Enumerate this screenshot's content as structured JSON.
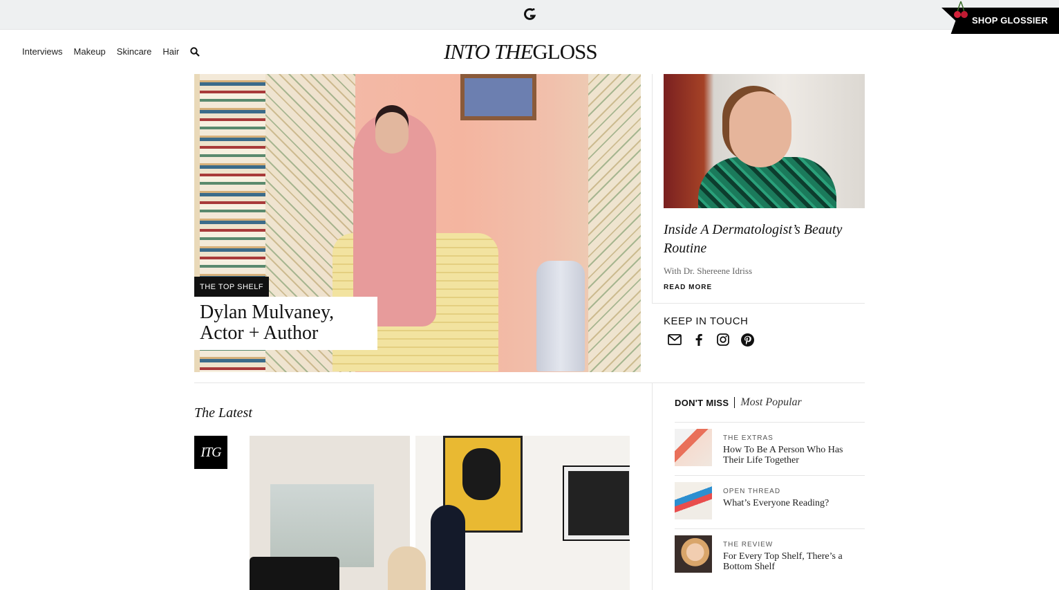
{
  "topbar": {
    "logo_icon": "glossier-g-icon"
  },
  "nav": {
    "links": [
      "Interviews",
      "Makeup",
      "Skincare",
      "Hair"
    ],
    "search_icon": "search-icon",
    "logo_italic": "INTO THE",
    "logo_plain": "GLOSS",
    "shop_label": "SHOP GLOSSIER"
  },
  "hero": {
    "tag": "THE TOP SHELF",
    "title_line1": "Dylan Mulvaney,",
    "title_line2": "Actor + Author"
  },
  "side_feature": {
    "title": "Inside A Dermatologist’s Beauty Routine",
    "subtitle": "With Dr. Shereene Idriss",
    "read_more": "READ MORE"
  },
  "keep_in_touch": {
    "heading": "KEEP IN TOUCH",
    "icons": [
      "mail-icon",
      "facebook-icon",
      "instagram-icon",
      "pinterest-icon"
    ]
  },
  "latest": {
    "heading": "The Latest",
    "badge": "ITG"
  },
  "dont_miss": {
    "tab_active": "DON'T MISS",
    "tab_inactive": "Most Popular",
    "items": [
      {
        "category": "THE EXTRAS",
        "title": "How To Be A Person Who Has Their Life Together"
      },
      {
        "category": "OPEN THREAD",
        "title": "What’s Everyone Reading?"
      },
      {
        "category": "THE REVIEW",
        "title": "For Every Top Shelf, There’s a Bottom Shelf"
      }
    ]
  },
  "colors": {
    "accent": "#000000",
    "topbar_bg": "#eef0f1",
    "cherry": "#d4213a"
  }
}
